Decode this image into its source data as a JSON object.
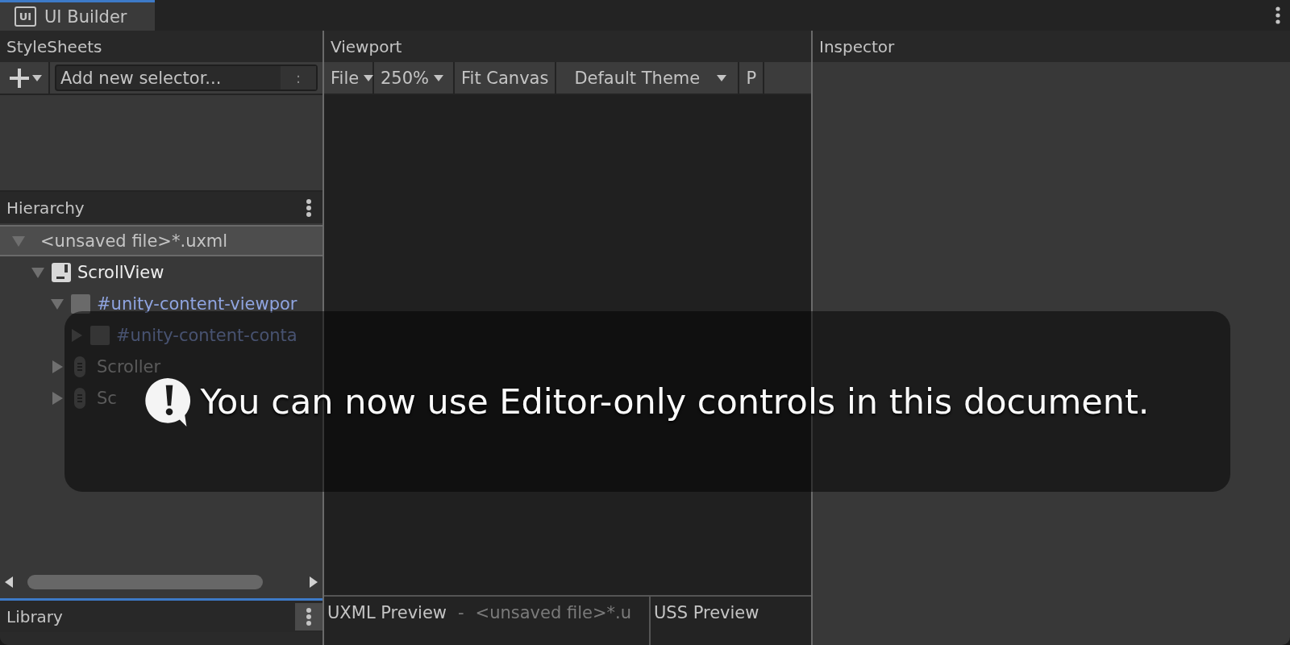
{
  "window": {
    "tab": {
      "icon_text": "UI",
      "label": "UI Builder",
      "selected": true
    }
  },
  "stylesheets": {
    "title": "StyleSheets",
    "selector_field": {
      "placeholder": "Add new selector...",
      "options_glyph": ":"
    }
  },
  "hierarchy": {
    "title": "Hierarchy",
    "tree": [
      {
        "kind": "document",
        "label": "<unsaved file>*.uxml",
        "selected": true,
        "expanded": true,
        "children": [
          {
            "kind": "scrollview",
            "label": "ScrollView",
            "selected": false,
            "expanded": true,
            "children": [
              {
                "kind": "internal",
                "label": "#unity-content-viewpor",
                "selected": false,
                "expanded": true,
                "children": [
                  {
                    "kind": "internal",
                    "label": "#unity-content-conta",
                    "selected": false,
                    "expanded": false
                  }
                ]
              },
              {
                "kind": "scroller",
                "label": "Scroller",
                "selected": false,
                "expanded": false
              },
              {
                "kind": "scroller",
                "label": "Sc",
                "selected": false,
                "expanded": false
              }
            ]
          }
        ]
      }
    ]
  },
  "library": {
    "title": "Library"
  },
  "viewport": {
    "title": "Viewport",
    "toolbar": [
      {
        "kind": "menu",
        "label": "File"
      },
      {
        "kind": "dropdown",
        "label": "250%"
      },
      {
        "kind": "button",
        "label": "Fit Canvas"
      },
      {
        "kind": "dropdown",
        "label": "Default Theme"
      },
      {
        "kind": "button",
        "label": "P"
      }
    ]
  },
  "uxml_preview": {
    "title": "UXML Preview",
    "separator": "-",
    "file": "<unsaved file>*.u"
  },
  "uss_preview": {
    "title": "USS Preview"
  },
  "inspector": {
    "title": "Inspector"
  },
  "notification": {
    "message": "You can now use Editor-only controls in this document."
  }
}
